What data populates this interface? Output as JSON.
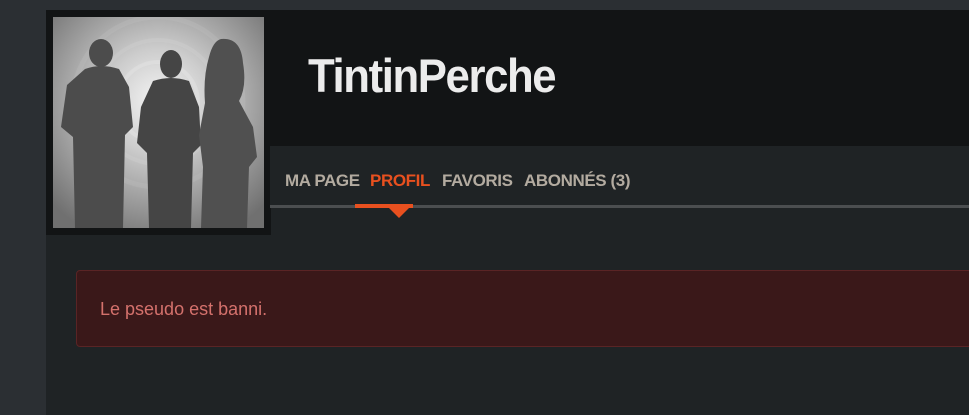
{
  "profile": {
    "username": "TintinPerche",
    "avatar_alt": "avatar"
  },
  "nav": {
    "tabs": [
      {
        "label": "MA PAGE",
        "active": false
      },
      {
        "label": "PROFIL",
        "active": true
      },
      {
        "label": "FAVORIS",
        "active": false
      },
      {
        "label": "ABONNÉS (3)",
        "active": false
      }
    ]
  },
  "alert": {
    "message": "Le pseudo est banni."
  },
  "colors": {
    "accent": "#e8501f",
    "alert_bg": "#3a1819",
    "alert_text": "#d4716c"
  }
}
